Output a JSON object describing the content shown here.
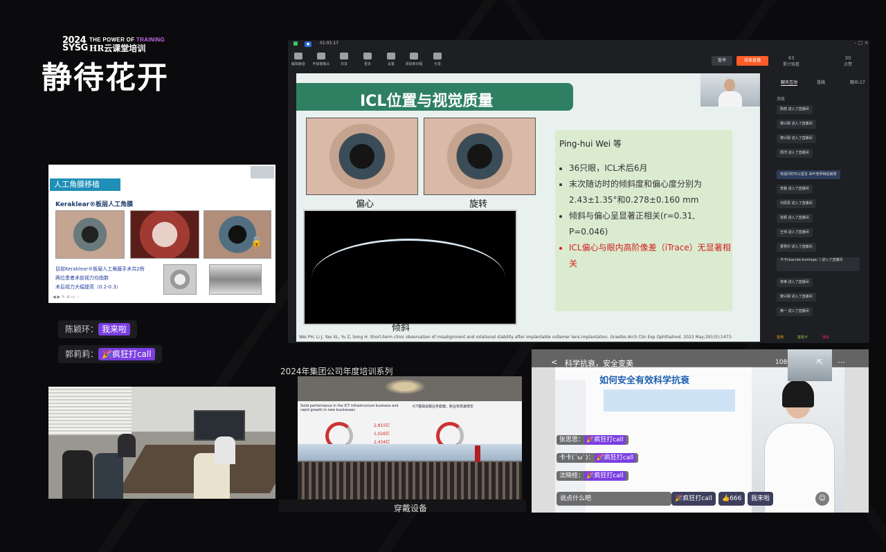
{
  "logo": {
    "year": "2024",
    "org": "SYSG",
    "tagline_a": "THE POWER OF ",
    "tagline_b": "TRAINING",
    "subtitle": "HR云课堂培训",
    "slogan": "静待花开"
  },
  "meeting": {
    "timer": "01:05:17",
    "toolbar": [
      "解除静音",
      "开启摄像头",
      "共享",
      "更多",
      "设置",
      "添加到日程",
      "分享"
    ],
    "end_meeting": "结束直播",
    "stats": [
      {
        "value": "43",
        "label": "累计观看"
      },
      {
        "value": "30",
        "label": "点赞"
      }
    ],
    "tabs": [
      "聊天互动",
      "连线",
      "观众:17"
    ],
    "chat_header": "消息",
    "chat_messages": [
      "陈丽 进入了直播间",
      "黎兴驿 进入了直播间",
      "黎兴驿 进入了直播间",
      "周洋 进入了直播间",
      "有提问的可以留言 由叶老师稍后解答",
      "李鑫 进入了直播间",
      "刘思思 进入了直播间",
      "张颖 进入了直播间",
      "王伟 进入了直播间",
      "曹慧玲 进入了直播间",
      "卡卡(&acute;&omega;`) 进入了直播间",
      "朱琳 进入了直播间",
      "黎兴驿 进入了直播间",
      "黄一 进入了直播间"
    ],
    "bottom_actions": [
      "签到",
      "答题卡",
      "抽奖"
    ],
    "slide": {
      "title": "ICL位置与视觉质量",
      "caption_a": "偏心",
      "caption_b": "旋转",
      "caption_c": "倾斜",
      "author": "Ping-hui Wei 等",
      "bullets": [
        "36只眼，ICL术后6月",
        "末次随访时的倾斜度和偏心度分别为2.43±1.35°和0.278±0.160 mm",
        "倾斜与偏心呈显著正相关(r=0.31, P=0.046)",
        "ICL偏心与眼内高阶像差（iTrace）无显著相关"
      ],
      "citation": "Wei PH, Li J, Yao XL, Yu Z, Song H. Short-term clinic observation of misalignment and rotational stability after implantable collamer lens implantation. Graefes Arch Clin Exp Ophthalmol. 2023 May;291(5):1473-"
    }
  },
  "kpro": {
    "header": "人工角膜移植",
    "sub": "Keraklear®板层人工角膜",
    "lines": [
      "目前Keraklear®板层人工角膜手术共2例",
      "两位患者术前视力均指数",
      "术后视力大幅提高（0.2-0.3）"
    ]
  },
  "left_chat": [
    {
      "name": "陈颖环：",
      "msg": "我来啦"
    },
    {
      "name": "郭莉莉：",
      "msg": "🎉疯狂打call"
    }
  ],
  "conference": {
    "title": "2024年集团公司年度培训系列",
    "caption": "穿戴设备",
    "slide_left": "Solid performance in the ICT infrastructure business and rapid growth in new businesses",
    "slide_right": "ICT基础设施业务稳健，新业务高速增长",
    "stats": [
      "2,815亿",
      "1,026亿",
      "2,434亿"
    ]
  },
  "live": {
    "title_bar": "科学抗衰，安全变美",
    "quality": "1080p",
    "slide_title": "如何安全有效科学抗衰",
    "comments": [
      {
        "name": "张思思：",
        "msg": "🎉疯狂打call"
      },
      {
        "name": "卡卡(ˊωˋ)：",
        "msg": "🎉疯狂打call"
      },
      {
        "name": "沈晓桂：",
        "msg": "🎉疯狂打call"
      }
    ],
    "input_placeholder": "说点什么吧",
    "bottom_chips": [
      "🎉疯狂打call",
      "👍666",
      "我来啦"
    ]
  }
}
